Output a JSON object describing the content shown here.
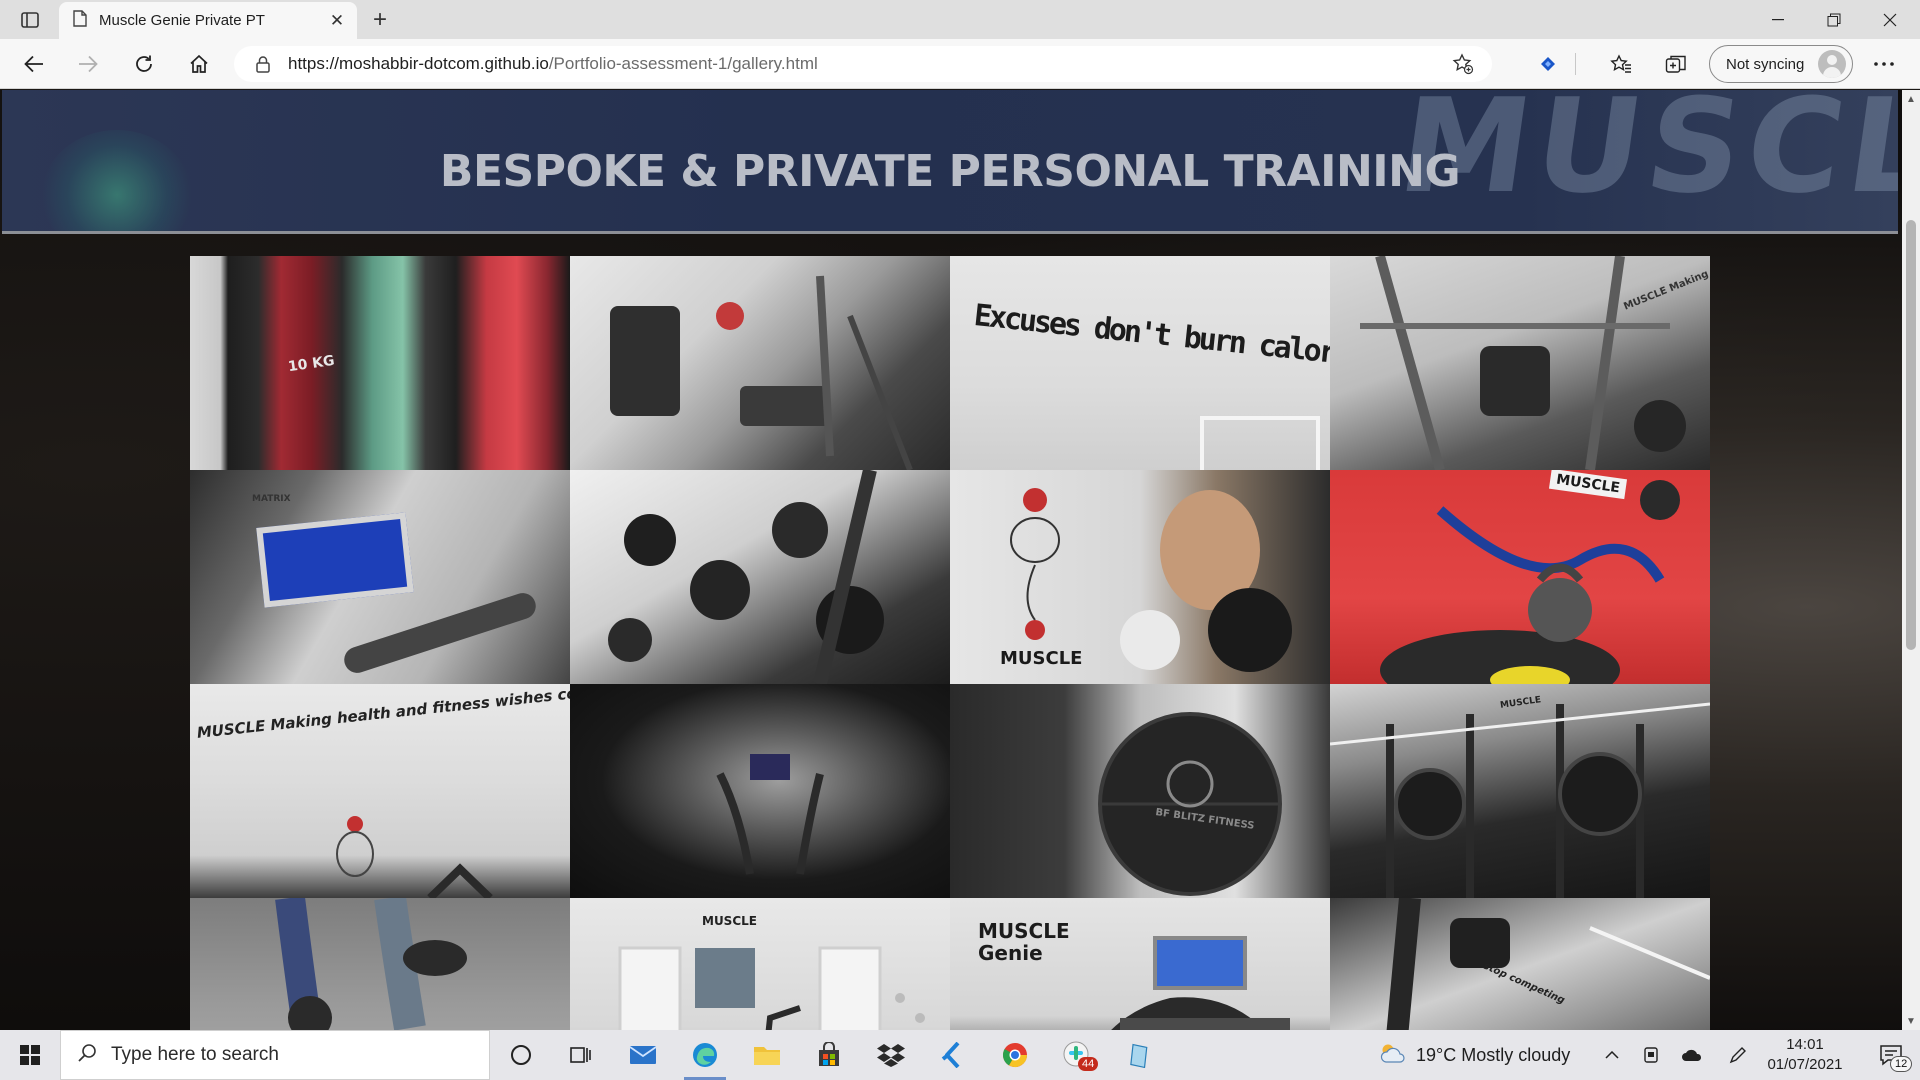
{
  "browser": {
    "tab_title": "Muscle Genie Private PT",
    "url_host": "https://moshabbir-dotcom.github.io",
    "url_path": "/Portfolio-assessment-1/gallery.html",
    "sync_label": "Not syncing"
  },
  "page": {
    "banner_title": "BESPOKE & PRIVATE PERSONAL TRAINING",
    "banner_watermark": "MUSCL",
    "gallery": [
      {
        "name": "weight-plates",
        "caption": "10 KG"
      },
      {
        "name": "cable-machine",
        "caption": ""
      },
      {
        "name": "excuses-wall",
        "caption": "Excuses don't burn calories"
      },
      {
        "name": "smith-machine",
        "caption": "MUSCLE Making heal"
      },
      {
        "name": "treadmill-console",
        "caption": "MATRIX"
      },
      {
        "name": "dumbbell-rack",
        "caption": ""
      },
      {
        "name": "boxing-dummy",
        "caption": "MUSCLE"
      },
      {
        "name": "kettlebell-mat",
        "caption": "MUSCLE"
      },
      {
        "name": "slogan-wall",
        "caption": "MUSCLE Making health and fitness wishes come true"
      },
      {
        "name": "cross-trainer",
        "caption": ""
      },
      {
        "name": "medicine-ball",
        "caption": "BF BLITZ FITNESS"
      },
      {
        "name": "power-rack",
        "caption": "MUSCLE"
      },
      {
        "name": "kettlebell-legs",
        "caption": ""
      },
      {
        "name": "gym-room",
        "caption": "MUSCLE"
      },
      {
        "name": "treadmill-display",
        "caption": "MUSCLE Genie"
      },
      {
        "name": "rack-closeup",
        "caption": "stop competing"
      }
    ]
  },
  "taskbar": {
    "search_placeholder": "Type here to search",
    "weather": "19°C  Mostly cloudy",
    "time": "14:01",
    "date": "01/07/2021",
    "chrome_badge": "44",
    "notif_badge": "12"
  }
}
